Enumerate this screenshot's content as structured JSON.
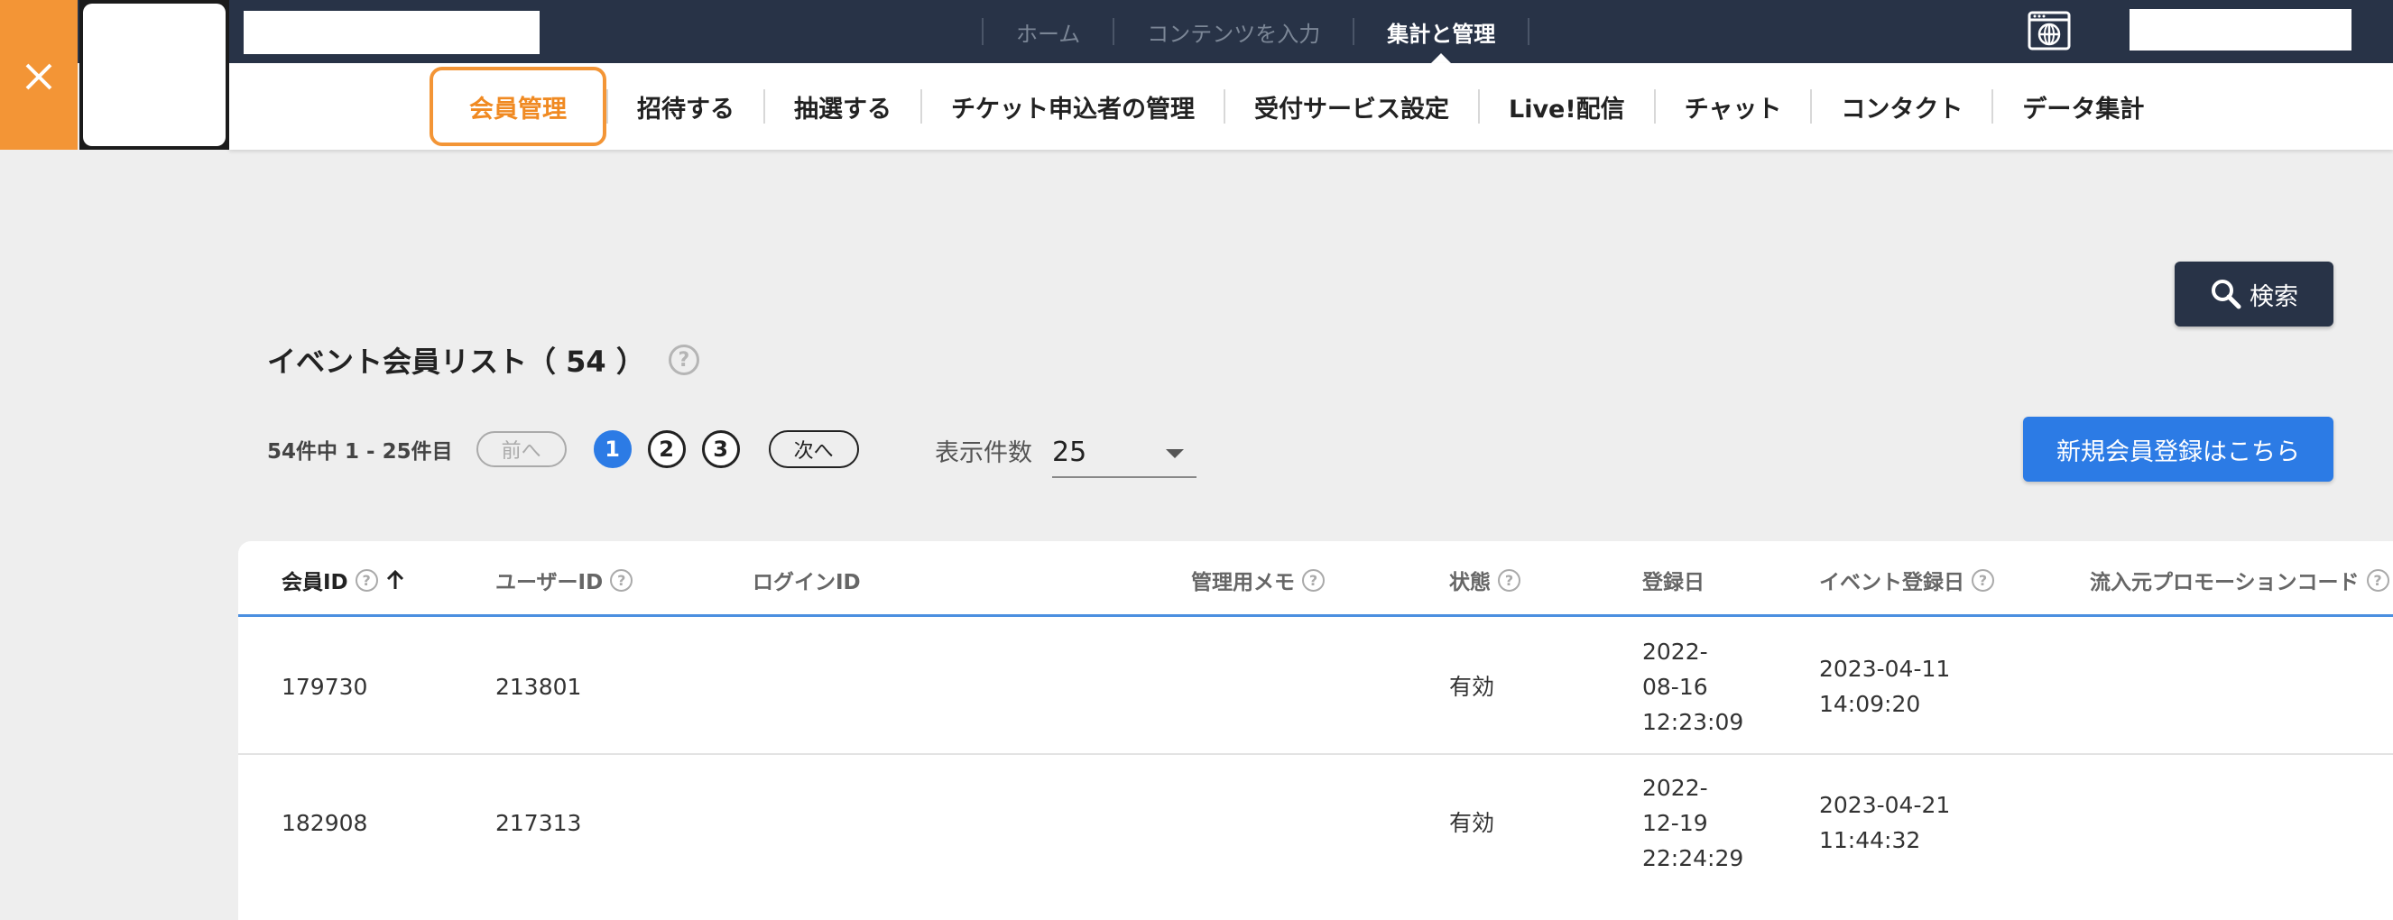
{
  "top_nav": {
    "items": [
      {
        "label": "ホーム"
      },
      {
        "label": "コンテンツを入力"
      },
      {
        "label": "集計と管理",
        "active": true
      }
    ]
  },
  "sub_nav": {
    "items": [
      {
        "label": "会員管理",
        "active": true
      },
      {
        "label": "招待する"
      },
      {
        "label": "抽選する"
      },
      {
        "label": "チケット申込者の管理"
      },
      {
        "label": "受付サービス設定"
      },
      {
        "label": "Live!配信"
      },
      {
        "label": "チャット"
      },
      {
        "label": "コンタクト"
      },
      {
        "label": "データ集計"
      }
    ]
  },
  "search_button": {
    "label": "検索"
  },
  "list": {
    "title": "イベント会員リスト（ 54 ）",
    "help_glyph": "?"
  },
  "pagination": {
    "summary": "54件中 1 - 25件目",
    "prev_label": "前へ",
    "pages": [
      "1",
      "2",
      "3"
    ],
    "current_page": "1",
    "next_label": "次へ"
  },
  "per_page": {
    "label": "表示件数",
    "value": "25"
  },
  "register_button": {
    "label": "新規会員登録はこちら"
  },
  "table": {
    "headers": [
      {
        "label": "会員ID",
        "help": true,
        "sort": "asc"
      },
      {
        "label": "ユーザーID",
        "help": true
      },
      {
        "label": "ログインID"
      },
      {
        "label": "管理用メモ",
        "help": true
      },
      {
        "label": "状態",
        "help": true
      },
      {
        "label": "登録日"
      },
      {
        "label": "イベント登録日",
        "help": true
      },
      {
        "label": "流入元プロモーションコード",
        "help": true
      }
    ],
    "rows": [
      {
        "member_id": "179730",
        "user_id": "213801",
        "login_id": "",
        "memo": "",
        "status": "有効",
        "registered": [
          "2022-",
          "08-16",
          "12:23:09"
        ],
        "event_registered": [
          "2023-04-11",
          "14:09:20"
        ],
        "promo_code": ""
      },
      {
        "member_id": "182908",
        "user_id": "217313",
        "login_id": "",
        "memo": "",
        "status": "有効",
        "registered": [
          "2022-",
          "12-19",
          "22:24:29"
        ],
        "event_registered": [
          "2023-04-21",
          "11:44:32"
        ],
        "promo_code": ""
      }
    ]
  },
  "colors": {
    "header_bg": "#283347",
    "accent_orange": "#f39536",
    "primary_blue": "#2c7be5",
    "page_bg": "#eeeeee"
  },
  "icons": {
    "close": "close-icon",
    "globe": "globe-browser-icon",
    "search": "search-icon",
    "sort": "arrow-up-icon",
    "help": "help-icon"
  }
}
